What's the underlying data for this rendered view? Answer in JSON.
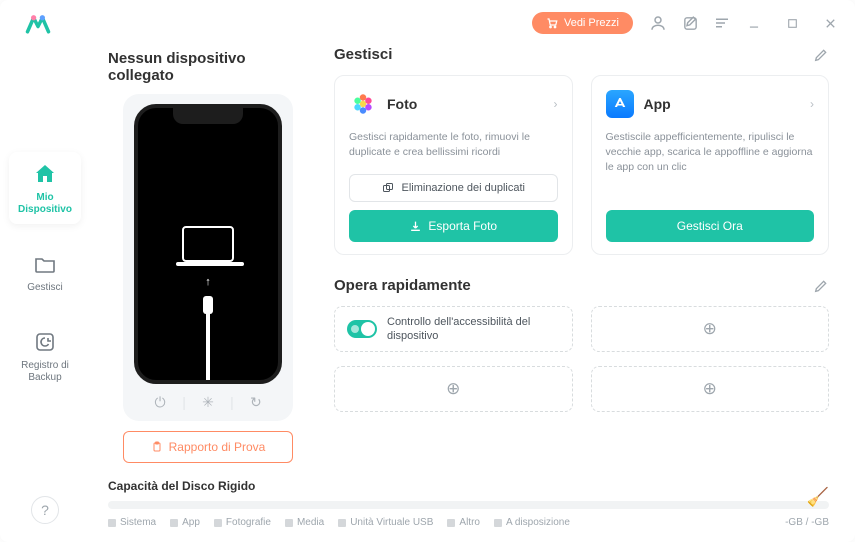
{
  "topbar": {
    "pricing_label": "Vedi Prezzi"
  },
  "sidebar": {
    "items": [
      {
        "label": "Mio Dispositivo"
      },
      {
        "label": "Gestisci"
      },
      {
        "label": "Registro di Backup"
      }
    ]
  },
  "device": {
    "title": "Nessun dispositivo collegato",
    "trial_label": "Rapporto di Prova"
  },
  "manage": {
    "title": "Gestisci",
    "foto": {
      "title": "Foto",
      "desc": "Gestisci rapidamente le foto, rimuovi le duplicate e crea bellissimi ricordi",
      "dup_label": "Eliminazione dei duplicati",
      "export_label": "Esporta Foto"
    },
    "app": {
      "title": "App",
      "desc": "Gestiscile appefficientemente, ripulisci le vecchie app, scarica le appoffline e aggiorna le app con un clic",
      "action_label": "Gestisci Ora"
    }
  },
  "quick": {
    "title": "Opera rapidamente",
    "accessibility_label": "Controllo dell'accessibilità del dispositivo"
  },
  "disk": {
    "title": "Capacità del Disco Rigido",
    "legend": [
      "Sistema",
      "App",
      "Fotografie",
      "Media",
      "Unità Virtuale USB",
      "Altro",
      "A disposizione"
    ],
    "size": "-GB / -GB"
  }
}
